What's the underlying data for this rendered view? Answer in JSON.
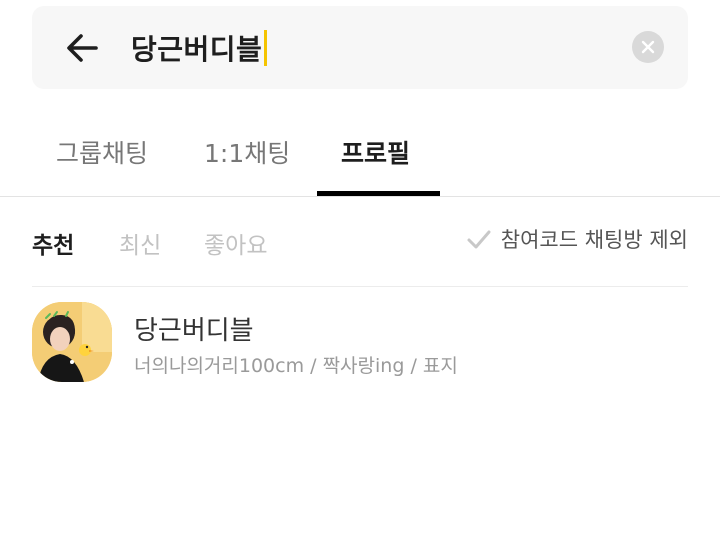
{
  "search": {
    "query": "당근버디블",
    "caret_color": "#f5c400"
  },
  "icons": {
    "back": "arrow-left-icon",
    "clear": "close-circle-icon",
    "check": "check-icon"
  },
  "tabs": [
    {
      "label": "그룹채팅",
      "active": false
    },
    {
      "label": "1:1채팅",
      "active": false
    },
    {
      "label": "프로필",
      "active": true
    }
  ],
  "filters": [
    {
      "label": "추천",
      "active": true
    },
    {
      "label": "최신",
      "active": false
    },
    {
      "label": "좋아요",
      "active": false
    }
  ],
  "exclude_option": {
    "label": "참여코드 채팅방 제외",
    "checked": false
  },
  "results": [
    {
      "name": "당근버디블",
      "description": "너의나의거리100cm / 짝사랑ing / 표지"
    }
  ]
}
